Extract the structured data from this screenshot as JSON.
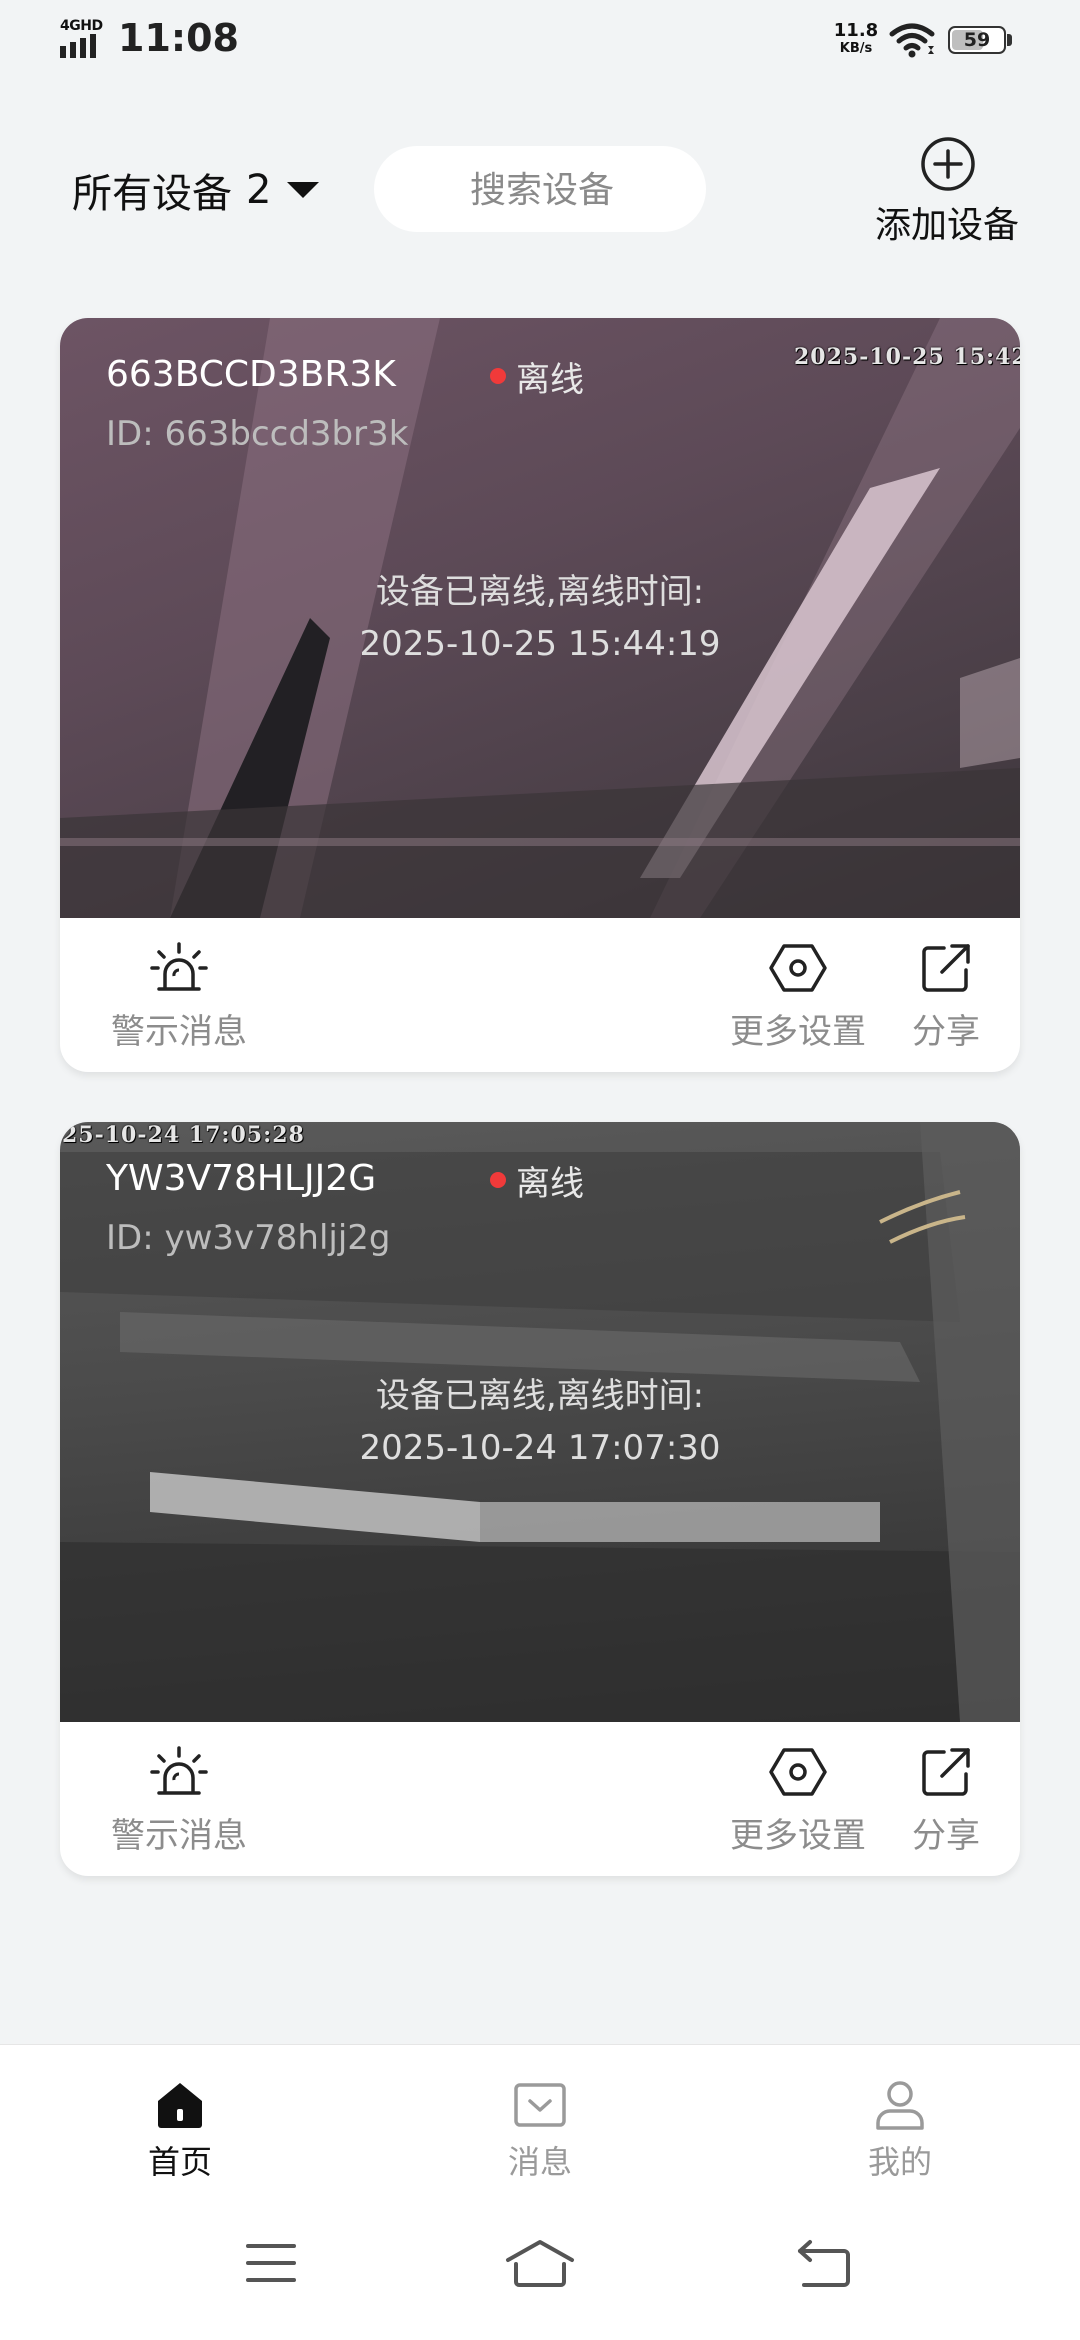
{
  "status_bar": {
    "network": "4GHD",
    "time": "11:08",
    "speed_value": "11.8",
    "speed_unit": "KB/s",
    "battery": "59"
  },
  "header": {
    "filter_label": "所有设备",
    "filter_count": "2",
    "search_placeholder": "搜索设备",
    "add_device_label": "添加设备"
  },
  "devices": [
    {
      "name": "663BCCD3BR3K",
      "id": "ID: 663bccd3br3k",
      "status": "离线",
      "osd_timestamp": "2025-10-25 15:42:",
      "offline_line1": "设备已离线,离线时间:",
      "offline_line2": "2025-10-25 15:44:19",
      "actions": {
        "alarm": "警示消息",
        "settings": "更多设置",
        "share": "分享"
      }
    },
    {
      "name": "YW3V78HLJJ2G",
      "id": "ID: yw3v78hljj2g",
      "status": "离线",
      "osd_timestamp": "25-10-24  17:05:28",
      "offline_line1": "设备已离线,离线时间:",
      "offline_line2": "2025-10-24 17:07:30",
      "actions": {
        "alarm": "警示消息",
        "settings": "更多设置",
        "share": "分享"
      }
    }
  ],
  "bottom_nav": {
    "home": "首页",
    "messages": "消息",
    "me": "我的"
  },
  "colors": {
    "background": "#f2f4f5",
    "offline_dot": "#f03a3a",
    "active_nav": "#111111",
    "inactive_nav": "#9a9a9a"
  },
  "icons": [
    "add-circle-icon",
    "alarm-siren-icon",
    "hexagon-settings-icon",
    "share-icon",
    "home-icon",
    "message-icon",
    "user-icon",
    "menu-icon",
    "system-home-icon",
    "back-icon"
  ]
}
